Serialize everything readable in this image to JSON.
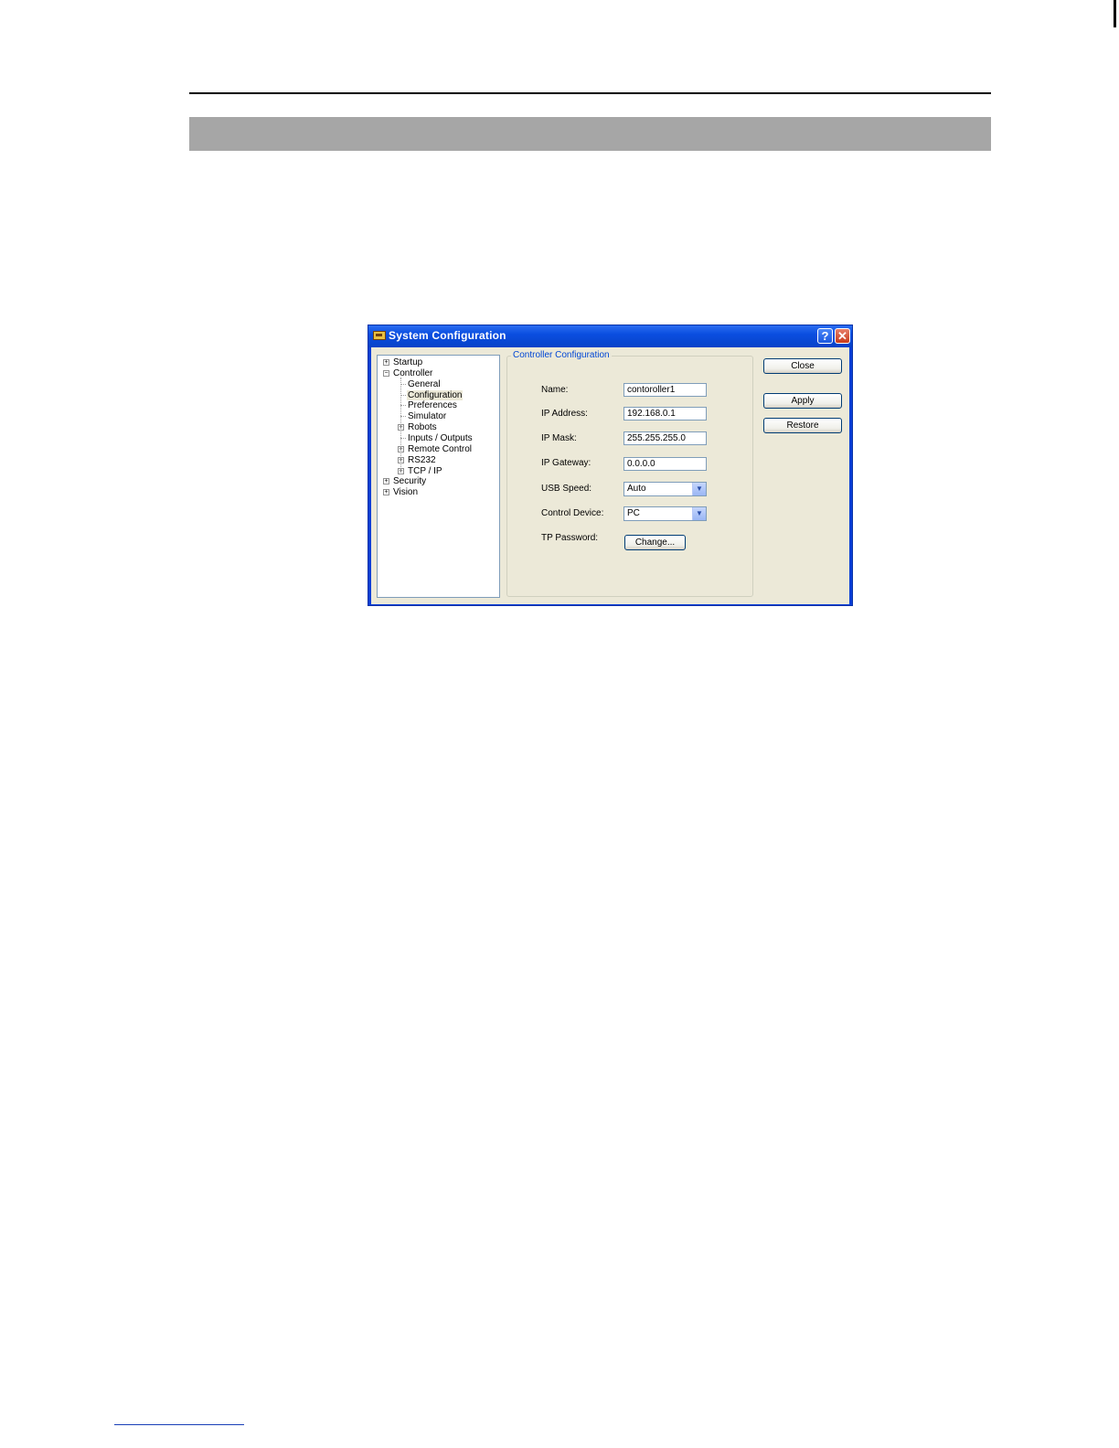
{
  "dialog": {
    "title": "System Configuration",
    "help_glyph": "?",
    "close_glyph": "✕"
  },
  "tree": {
    "items": [
      {
        "label": "Startup",
        "level": 0,
        "expander": "+"
      },
      {
        "label": "Controller",
        "level": 0,
        "expander": "−"
      },
      {
        "label": "General",
        "level": 1,
        "expander": ""
      },
      {
        "label": "Configuration",
        "level": 1,
        "expander": "",
        "selected": true
      },
      {
        "label": "Preferences",
        "level": 1,
        "expander": ""
      },
      {
        "label": "Simulator",
        "level": 1,
        "expander": ""
      },
      {
        "label": "Robots",
        "level": 1,
        "expander": "+"
      },
      {
        "label": "Inputs / Outputs",
        "level": 1,
        "expander": ""
      },
      {
        "label": "Remote Control",
        "level": 1,
        "expander": "+"
      },
      {
        "label": "RS232",
        "level": 1,
        "expander": "+"
      },
      {
        "label": "TCP / IP",
        "level": 1,
        "expander": "+"
      },
      {
        "label": "Security",
        "level": 0,
        "expander": "+"
      },
      {
        "label": "Vision",
        "level": 0,
        "expander": "+"
      }
    ]
  },
  "config": {
    "group_title": "Controller Configuration",
    "name_label": "Name:",
    "name_value": "contoroller1",
    "ip_label": "IP Address:",
    "ip_value": "192.168.0.1",
    "mask_label": "IP Mask:",
    "mask_value": "255.255.255.0",
    "gateway_label": "IP Gateway:",
    "gateway_value": "0.0.0.0",
    "usb_label": "USB Speed:",
    "usb_value": "Auto",
    "control_label": "Control Device:",
    "control_value": "PC",
    "tp_label": "TP Password:",
    "change_button": "Change..."
  },
  "buttons": {
    "close": "Close",
    "apply": "Apply",
    "restore": "Restore"
  }
}
